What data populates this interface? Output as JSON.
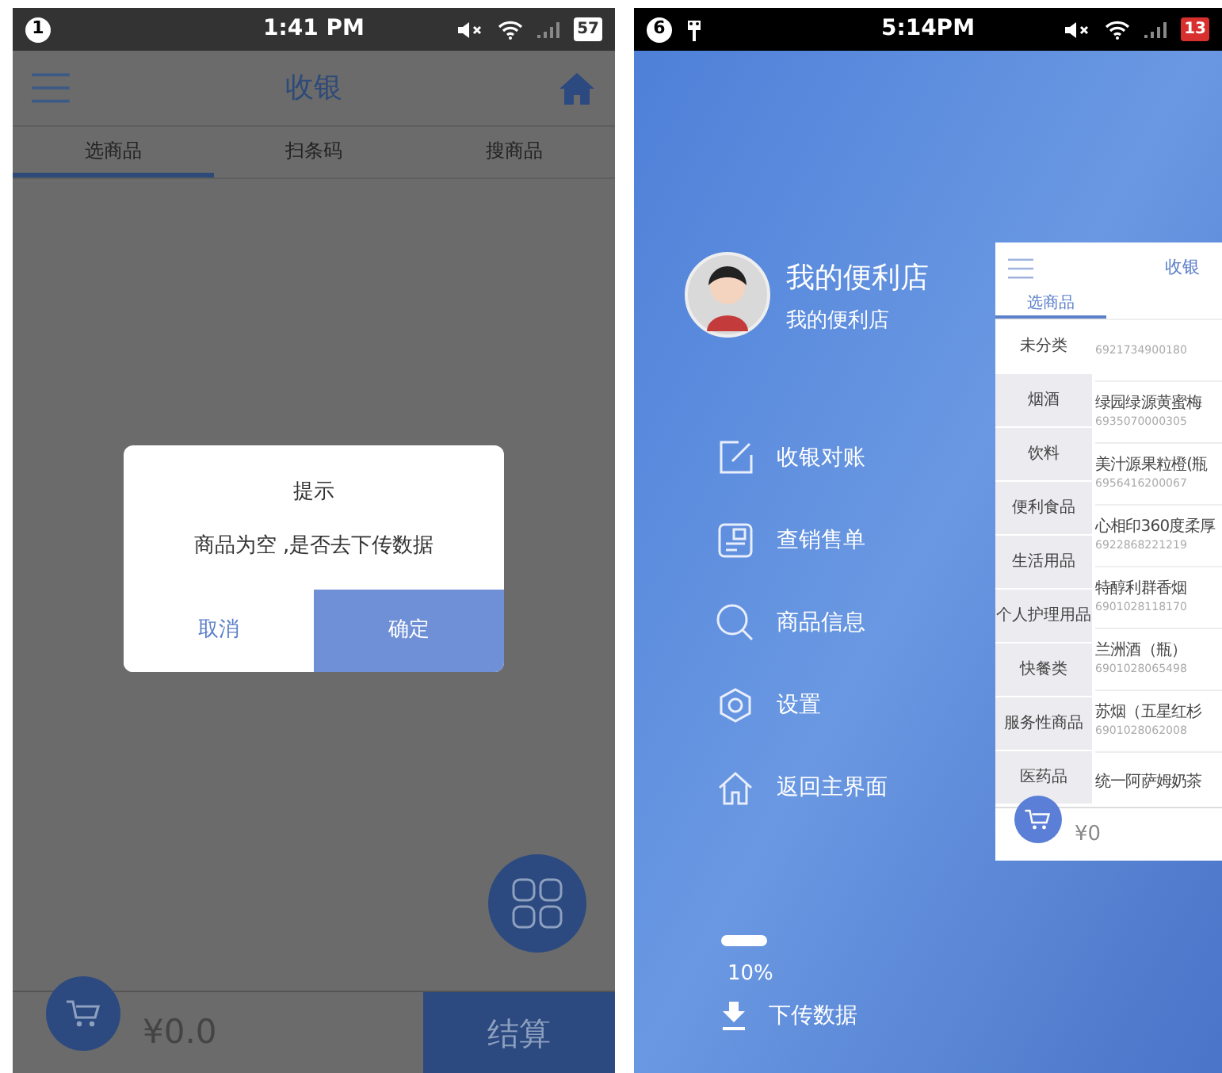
{
  "left_phone": {
    "status_bar": {
      "notification_count": "1",
      "time": "1:41 PM",
      "battery": "57"
    },
    "header": {
      "title": "收银"
    },
    "tabs": [
      {
        "label": "选商品",
        "selected": true
      },
      {
        "label": "扫条码",
        "selected": false
      },
      {
        "label": "搜商品",
        "selected": false
      }
    ],
    "dialog": {
      "title": "提示",
      "message": "商品为空 ,是否去下传数据",
      "buttons": [
        {
          "label": "取消",
          "kind": "cancel"
        },
        {
          "label": "确定",
          "kind": "confirm"
        }
      ]
    },
    "cart_total": "¥0.0",
    "checkout_button": "结算"
  },
  "right_phone": {
    "status_bar": {
      "notification_count": "6",
      "time": "5:14PM",
      "battery": "13"
    },
    "drawer": {
      "store_name": "我的便利店",
      "store_subtitle": "我的便利店",
      "menu": [
        {
          "label": "收银对账"
        },
        {
          "label": "查销售单"
        },
        {
          "label": "商品信息"
        },
        {
          "label": "设置"
        },
        {
          "label": "返回主界面"
        }
      ],
      "download": {
        "level": 0.1,
        "percent": "10%",
        "label": "下传数据"
      }
    },
    "app_preview": {
      "title": "收银",
      "tabs": [
        {
          "label": "选商品",
          "selected": true
        }
      ],
      "categories": [
        {
          "label": "未分类",
          "selected": true
        },
        {
          "label": "烟酒",
          "selected": false
        },
        {
          "label": "饮料",
          "selected": false
        },
        {
          "label": "便利食品",
          "selected": false
        },
        {
          "label": "生活用品",
          "selected": false
        },
        {
          "label": "个人护理用品",
          "selected": false
        },
        {
          "label": "快餐类",
          "selected": false
        },
        {
          "label": "服务性商品",
          "selected": false
        },
        {
          "label": "医药品",
          "selected": false
        }
      ],
      "products": [
        {
          "code": "6921734900180"
        },
        {
          "name": "绿园绿源黄蜜梅",
          "code": "6935070000305"
        },
        {
          "name": "美汁源果粒橙(瓶",
          "code": "6956416200067"
        },
        {
          "name": "心相印360度柔厚",
          "code": "6922868221219"
        },
        {
          "name": "特醇利群香烟",
          "code": "6901028118170"
        },
        {
          "name": "兰洲酒（瓶）",
          "code": "6901028065498"
        },
        {
          "name": "苏烟（五星红杉",
          "code": "6901028062008"
        },
        {
          "name": "统一阿萨姆奶茶"
        }
      ],
      "cart_total": "¥0"
    }
  }
}
